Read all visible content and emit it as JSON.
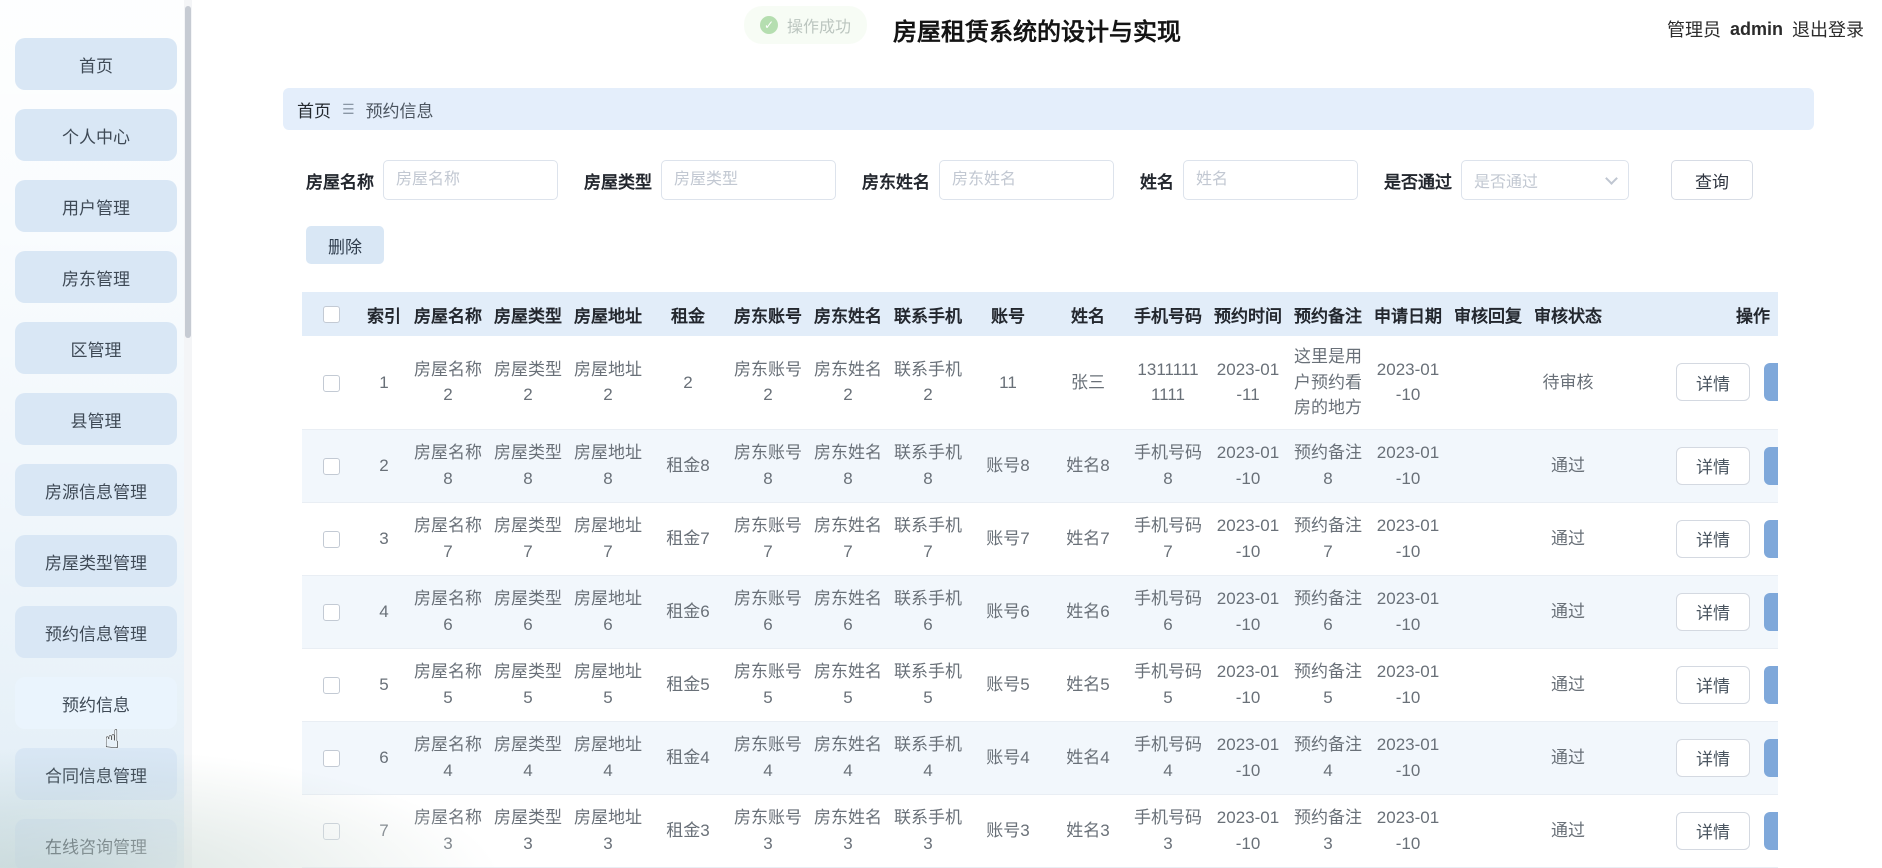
{
  "header": {
    "title": "房屋租赁系统的设计与实现",
    "user_role": "管理员",
    "username": "admin",
    "logout": "退出登录"
  },
  "toast": {
    "message": "操作成功"
  },
  "icons": {
    "toast_check": "✓",
    "breadcrumb_menu": "☰",
    "cursor": "☝"
  },
  "sidebar": {
    "items": [
      {
        "label": "首页"
      },
      {
        "label": "个人中心"
      },
      {
        "label": "用户管理"
      },
      {
        "label": "房东管理"
      },
      {
        "label": "区管理"
      },
      {
        "label": "县管理"
      },
      {
        "label": "房源信息管理"
      },
      {
        "label": "房屋类型管理"
      },
      {
        "label": "预约信息管理"
      },
      {
        "label": "预约信息",
        "active": true
      },
      {
        "label": "合同信息管理"
      },
      {
        "label": "在线咨询管理"
      }
    ]
  },
  "breadcrumb": {
    "home": "首页",
    "current": "预约信息"
  },
  "filters": {
    "fields": [
      {
        "label": "房屋名称",
        "placeholder": "房屋名称",
        "type": "input"
      },
      {
        "label": "房屋类型",
        "placeholder": "房屋类型",
        "type": "input"
      },
      {
        "label": "房东姓名",
        "placeholder": "房东姓名",
        "type": "input"
      },
      {
        "label": "姓名",
        "placeholder": "姓名",
        "type": "input"
      },
      {
        "label": "是否通过",
        "placeholder": "是否通过",
        "type": "select"
      }
    ],
    "search_label": "查询"
  },
  "actions": {
    "delete_label": "删除"
  },
  "table": {
    "columns": [
      "索引",
      "房屋名称",
      "房屋类型",
      "房屋地址",
      "租金",
      "房东账号",
      "房东姓名",
      "联系手机",
      "账号",
      "姓名",
      "手机号码",
      "预约时间",
      "预约备注",
      "申请日期",
      "审核回复",
      "审核状态",
      "操作"
    ],
    "detail_label": "详情",
    "rows": [
      {
        "index": "1",
        "house_name": "房屋名称2",
        "house_type": "房屋类型2",
        "house_address": "房屋地址2",
        "rent": "2",
        "landlord_account": "房东账号2",
        "landlord_name": "房东姓名2",
        "contact_phone": "联系手机2",
        "account": "11",
        "name": "张三",
        "phone": "13111111111",
        "reserve_time": "2023-01-11",
        "reserve_note": "这里是用户预约看房的地方",
        "apply_date": "2023-01-10",
        "review_reply": "",
        "review_status": "待审核"
      },
      {
        "index": "2",
        "house_name": "房屋名称8",
        "house_type": "房屋类型8",
        "house_address": "房屋地址8",
        "rent": "租金8",
        "landlord_account": "房东账号8",
        "landlord_name": "房东姓名8",
        "contact_phone": "联系手机8",
        "account": "账号8",
        "name": "姓名8",
        "phone": "手机号码8",
        "reserve_time": "2023-01-10",
        "reserve_note": "预约备注8",
        "apply_date": "2023-01-10",
        "review_reply": "",
        "review_status": "通过"
      },
      {
        "index": "3",
        "house_name": "房屋名称7",
        "house_type": "房屋类型7",
        "house_address": "房屋地址7",
        "rent": "租金7",
        "landlord_account": "房东账号7",
        "landlord_name": "房东姓名7",
        "contact_phone": "联系手机7",
        "account": "账号7",
        "name": "姓名7",
        "phone": "手机号码7",
        "reserve_time": "2023-01-10",
        "reserve_note": "预约备注7",
        "apply_date": "2023-01-10",
        "review_reply": "",
        "review_status": "通过"
      },
      {
        "index": "4",
        "house_name": "房屋名称6",
        "house_type": "房屋类型6",
        "house_address": "房屋地址6",
        "rent": "租金6",
        "landlord_account": "房东账号6",
        "landlord_name": "房东姓名6",
        "contact_phone": "联系手机6",
        "account": "账号6",
        "name": "姓名6",
        "phone": "手机号码6",
        "reserve_time": "2023-01-10",
        "reserve_note": "预约备注6",
        "apply_date": "2023-01-10",
        "review_reply": "",
        "review_status": "通过"
      },
      {
        "index": "5",
        "house_name": "房屋名称5",
        "house_type": "房屋类型5",
        "house_address": "房屋地址5",
        "rent": "租金5",
        "landlord_account": "房东账号5",
        "landlord_name": "房东姓名5",
        "contact_phone": "联系手机5",
        "account": "账号5",
        "name": "姓名5",
        "phone": "手机号码5",
        "reserve_time": "2023-01-10",
        "reserve_note": "预约备注5",
        "apply_date": "2023-01-10",
        "review_reply": "",
        "review_status": "通过"
      },
      {
        "index": "6",
        "house_name": "房屋名称4",
        "house_type": "房屋类型4",
        "house_address": "房屋地址4",
        "rent": "租金4",
        "landlord_account": "房东账号4",
        "landlord_name": "房东姓名4",
        "contact_phone": "联系手机4",
        "account": "账号4",
        "name": "姓名4",
        "phone": "手机号码4",
        "reserve_time": "2023-01-10",
        "reserve_note": "预约备注4",
        "apply_date": "2023-01-10",
        "review_reply": "",
        "review_status": "通过"
      },
      {
        "index": "7",
        "house_name": "房屋名称3",
        "house_type": "房屋类型3",
        "house_address": "房屋地址3",
        "rent": "租金3",
        "landlord_account": "房东账号3",
        "landlord_name": "房东姓名3",
        "contact_phone": "联系手机3",
        "account": "账号3",
        "name": "姓名3",
        "phone": "手机号码3",
        "reserve_time": "2023-01-10",
        "reserve_note": "预约备注3",
        "apply_date": "2023-01-10",
        "review_reply": "",
        "review_status": "通过"
      }
    ]
  }
}
